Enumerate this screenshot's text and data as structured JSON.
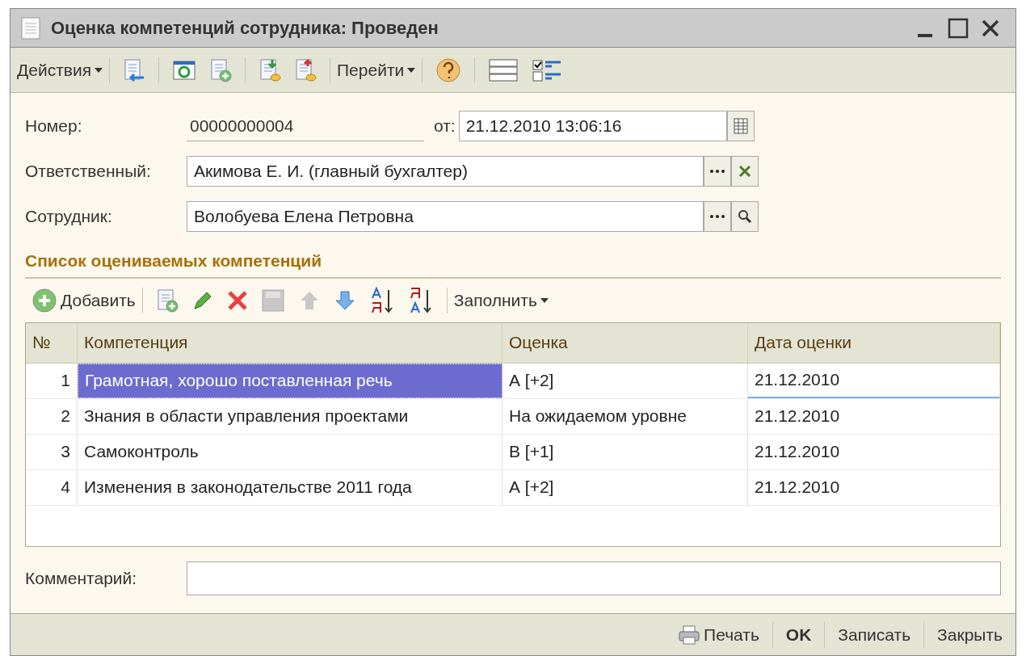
{
  "window": {
    "title": "Оценка компетенций сотрудника: Проведен"
  },
  "toolbar": {
    "actions_menu": "Действия",
    "goto_menu": "Перейти"
  },
  "form": {
    "number_label": "Номер:",
    "number": "00000000004",
    "date_label": "от:",
    "date": "21.12.2010 13:06:16",
    "responsible_label": "Ответственный:",
    "responsible": "Акимова Е. И. (главный бухгалтер)",
    "employee_label": "Сотрудник:",
    "employee": "Волобуева Елена Петровна"
  },
  "section_title": "Список оцениваемых компетенций",
  "table_toolbar": {
    "add": "Добавить",
    "fill_menu": "Заполнить"
  },
  "table": {
    "columns": [
      "№",
      "Компетенция",
      "Оценка",
      "Дата оценки"
    ],
    "rows": [
      {
        "n": "1",
        "competence": "Грамотная, хорошо поставленная речь",
        "grade": "А [+2]",
        "date": "21.12.2010",
        "selected": true
      },
      {
        "n": "2",
        "competence": "Знания в области управления проектами",
        "grade": "На ожидаемом уровне",
        "date": "21.12.2010",
        "selected": false
      },
      {
        "n": "3",
        "competence": "Самоконтроль",
        "grade": "В [+1]",
        "date": "21.12.2010",
        "selected": false
      },
      {
        "n": "4",
        "competence": "Изменения в законодательстве 2011 года",
        "grade": "А [+2]",
        "date": "21.12.2010",
        "selected": false
      }
    ]
  },
  "comment": {
    "label": "Комментарий:"
  },
  "footer": {
    "print": "Печать",
    "ok": "OK",
    "save": "Записать",
    "close": "Закрыть"
  }
}
